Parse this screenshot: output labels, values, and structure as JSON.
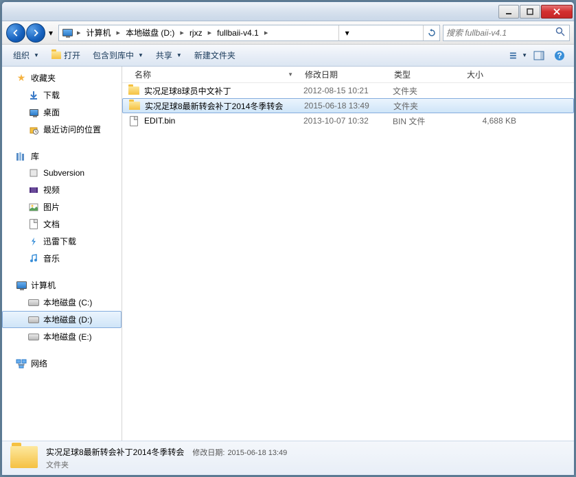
{
  "breadcrumb": [
    "计算机",
    "本地磁盘 (D:)",
    "rjxz",
    "fullbaii-v4.1"
  ],
  "search": {
    "placeholder": "搜索 fullbaii-v4.1"
  },
  "toolbar": {
    "organize": "组织",
    "open": "打开",
    "include": "包含到库中",
    "share": "共享",
    "newfolder": "新建文件夹"
  },
  "sidebar": {
    "favorites": {
      "label": "收藏夹",
      "items": [
        {
          "id": "downloads",
          "label": "下载",
          "icon": "download"
        },
        {
          "id": "desktop",
          "label": "桌面",
          "icon": "desktop"
        },
        {
          "id": "recent",
          "label": "最近访问的位置",
          "icon": "recent"
        }
      ]
    },
    "libraries": {
      "label": "库",
      "items": [
        {
          "id": "subversion",
          "label": "Subversion",
          "icon": "svn"
        },
        {
          "id": "videos",
          "label": "视频",
          "icon": "video"
        },
        {
          "id": "pictures",
          "label": "图片",
          "icon": "picture"
        },
        {
          "id": "documents",
          "label": "文档",
          "icon": "document"
        },
        {
          "id": "thunder",
          "label": "迅雷下载",
          "icon": "thunder"
        },
        {
          "id": "music",
          "label": "音乐",
          "icon": "music"
        }
      ]
    },
    "computer": {
      "label": "计算机",
      "items": [
        {
          "id": "drive-c",
          "label": "本地磁盘 (C:)",
          "icon": "drive"
        },
        {
          "id": "drive-d",
          "label": "本地磁盘 (D:)",
          "icon": "drive",
          "selected": true
        },
        {
          "id": "drive-e",
          "label": "本地磁盘 (E:)",
          "icon": "drive"
        }
      ]
    },
    "network": {
      "label": "网络"
    }
  },
  "columns": {
    "name": "名称",
    "date": "修改日期",
    "type": "类型",
    "size": "大小"
  },
  "files": [
    {
      "name": "实况足球8球员中文补丁",
      "date": "2012-08-15 10:21",
      "type": "文件夹",
      "size": "",
      "icon": "folder"
    },
    {
      "name": "实况足球8最新转会补丁2014冬季转会",
      "date": "2015-06-18 13:49",
      "type": "文件夹",
      "size": "",
      "icon": "folder",
      "selected": true
    },
    {
      "name": "EDIT.bin",
      "date": "2013-10-07 10:32",
      "type": "BIN 文件",
      "size": "4,688 KB",
      "icon": "file"
    }
  ],
  "status": {
    "name": "实况足球8最新转会补丁2014冬季转会",
    "type_label": "文件夹",
    "date_label": "修改日期:",
    "date_value": "2015-06-18 13:49"
  }
}
